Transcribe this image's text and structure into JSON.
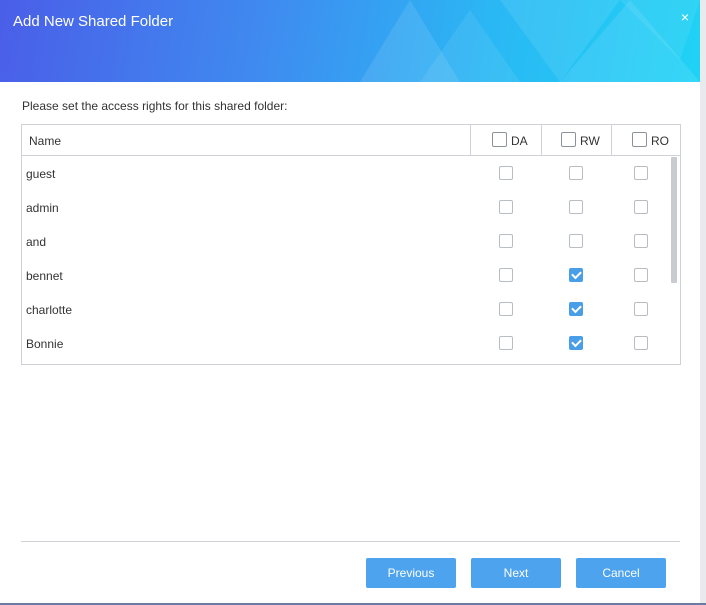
{
  "dialog": {
    "title": "Add New Shared Folder",
    "close_glyph": "×",
    "instruction": "Please set the access rights for this shared folder:"
  },
  "table": {
    "name_header": "Name",
    "columns": [
      {
        "key": "DA",
        "label": "DA",
        "header_checked": false
      },
      {
        "key": "RW",
        "label": "RW",
        "header_checked": false
      },
      {
        "key": "RO",
        "label": "RO",
        "header_checked": false
      }
    ],
    "rows": [
      {
        "name": "guest",
        "DA": false,
        "RW": false,
        "RO": false
      },
      {
        "name": "admin",
        "DA": false,
        "RW": false,
        "RO": false
      },
      {
        "name": "and",
        "DA": false,
        "RW": false,
        "RO": false
      },
      {
        "name": "bennet",
        "DA": false,
        "RW": true,
        "RO": false
      },
      {
        "name": "charlotte",
        "DA": false,
        "RW": true,
        "RO": false
      },
      {
        "name": "Bonnie",
        "DA": false,
        "RW": true,
        "RO": false
      }
    ]
  },
  "buttons": {
    "previous": "Previous",
    "next": "Next",
    "cancel": "Cancel"
  },
  "colors": {
    "accent": "#4da3ee",
    "checked": "#4a9ee8",
    "header_gradient_start": "#4a5ee8",
    "header_gradient_end": "#1fd3f5"
  }
}
